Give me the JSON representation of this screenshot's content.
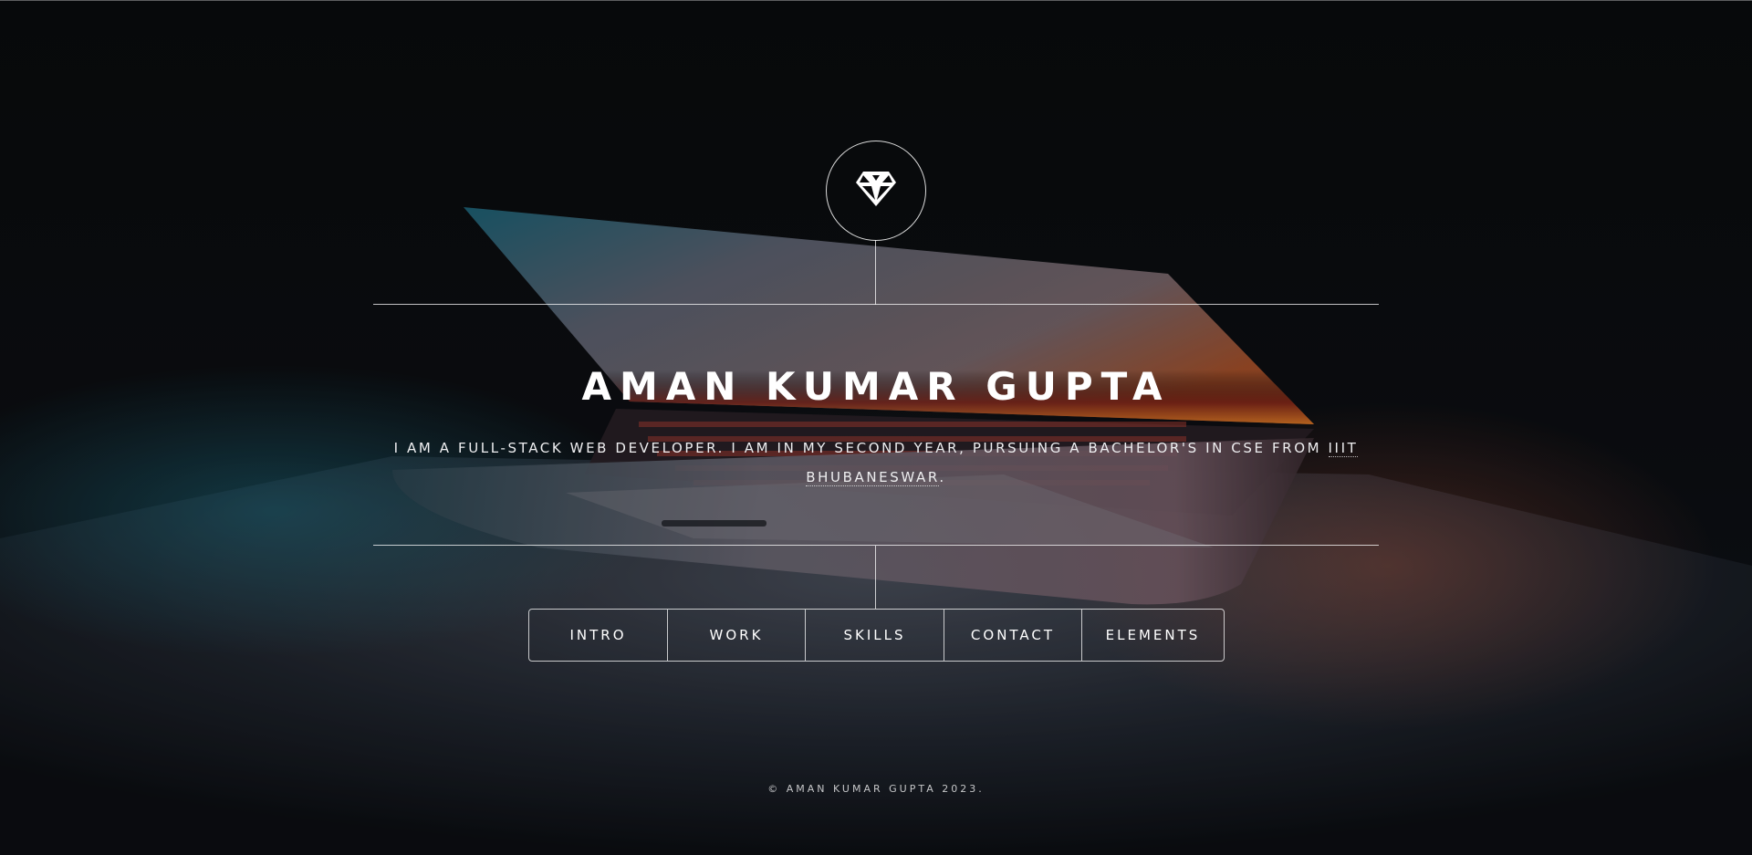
{
  "header": {
    "logo_icon": "diamond-icon",
    "name": "AMAN KUMAR GUPTA",
    "intro_prefix": "I am a full-stack web developer. I am in my second year, pursuing a bachelor's in CSE from ",
    "intro_link": "IIIT Bhubaneswar",
    "intro_suffix": "."
  },
  "nav": {
    "items": [
      {
        "label": "INTRO"
      },
      {
        "label": "WORK"
      },
      {
        "label": "SKILLS"
      },
      {
        "label": "CONTACT"
      },
      {
        "label": "ELEMENTS"
      }
    ]
  },
  "footer": {
    "copyright": "© AMAN KUMAR GUPTA 2023."
  },
  "colors": {
    "background": "#08090b",
    "text": "#ffffff",
    "line": "#ffffff"
  }
}
